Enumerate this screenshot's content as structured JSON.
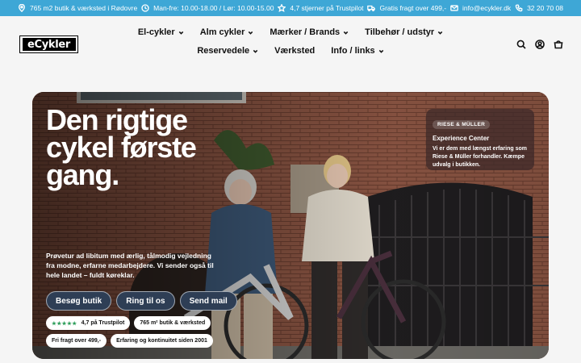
{
  "announcement": {
    "items": [
      {
        "icon": "location-pin-icon",
        "text": "765 m2 butik & værksted i Rødovre"
      },
      {
        "icon": "clock-icon",
        "text": "Man-fre: 10.00-18.00 / Lør: 10.00-15.00"
      },
      {
        "icon": "star-icon",
        "text": "4,7 stjerner på Trustpilot"
      },
      {
        "icon": "truck-icon",
        "text": "Gratis fragt over 499,-"
      },
      {
        "icon": "mail-icon",
        "text": "info@ecykler.dk"
      },
      {
        "icon": "phone-icon",
        "text": "32 20 70 08"
      }
    ]
  },
  "header": {
    "logo_text": "eCykler",
    "nav": [
      {
        "label": "El-cykler",
        "has_dropdown": true
      },
      {
        "label": "Alm cykler",
        "has_dropdown": true
      },
      {
        "label": "Mærker / Brands",
        "has_dropdown": true
      },
      {
        "label": "Tilbehør / udstyr",
        "has_dropdown": true
      },
      {
        "label": "Reservedele",
        "has_dropdown": true
      },
      {
        "label": "Værksted",
        "has_dropdown": false
      },
      {
        "label": "Info / links",
        "has_dropdown": true
      }
    ],
    "icons": [
      "search-icon",
      "account-icon",
      "cart-icon"
    ]
  },
  "hero": {
    "headline": "Den rigtige cykel første gang.",
    "subtext": "Prøvetur ad libitum med ærlig, tålmodig vejledning fra modne, erfarne medarbejdere. Vi sender også til hele landet – fuldt køreklar.",
    "buttons": [
      "Besøg butik",
      "Ring til os",
      "Send mail"
    ],
    "trust_badge": {
      "stars": "★★★★★",
      "text": "4,7 på Trustpilot"
    },
    "badges": [
      "765 m² butik & værksted",
      "Fri fragt over 499,-",
      "Erfaring og kontinuitet siden 2001"
    ],
    "experience": {
      "tag": "RIESE & MÜLLER",
      "title": "Experience Center",
      "body": "Vi er dem med længst erfaring som Riese & Müller forhandler. Kæmpe udvalg i butikken."
    }
  },
  "colors": {
    "topbar": "#3ea7d6",
    "button": "#2e3e55",
    "stars": "#2e9e5b"
  }
}
